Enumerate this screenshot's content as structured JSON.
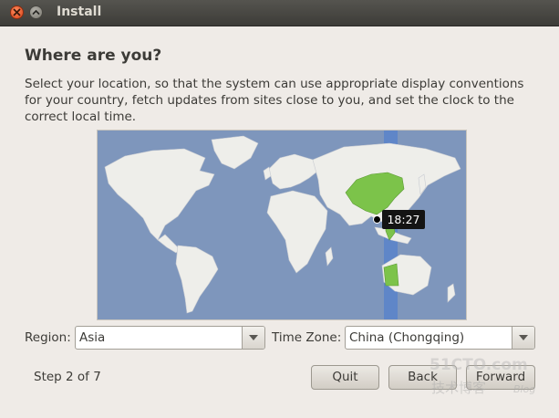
{
  "window": {
    "title": "Install"
  },
  "page": {
    "heading": "Where are you?",
    "description": "Select your location, so that the system can use appropriate display conventions for your country, fetch updates from sites close to you, and set the clock to the correct local time."
  },
  "map": {
    "time_label": "18:27",
    "ocean_color": "#7e96bc",
    "land_color": "#eeeeea",
    "highlight_color": "#7cc34a",
    "timezone_band_color": "#5f86c8"
  },
  "region": {
    "label": "Region:",
    "value": "Asia"
  },
  "timezone": {
    "label": "Time Zone:",
    "value": "China (Chongqing)"
  },
  "footer": {
    "step": "Step 2 of 7",
    "quit": "Quit",
    "back": "Back",
    "forward": "Forward"
  },
  "watermark": {
    "line1": "51CTO.com",
    "line2": "技术博客",
    "line3": "Blog"
  }
}
